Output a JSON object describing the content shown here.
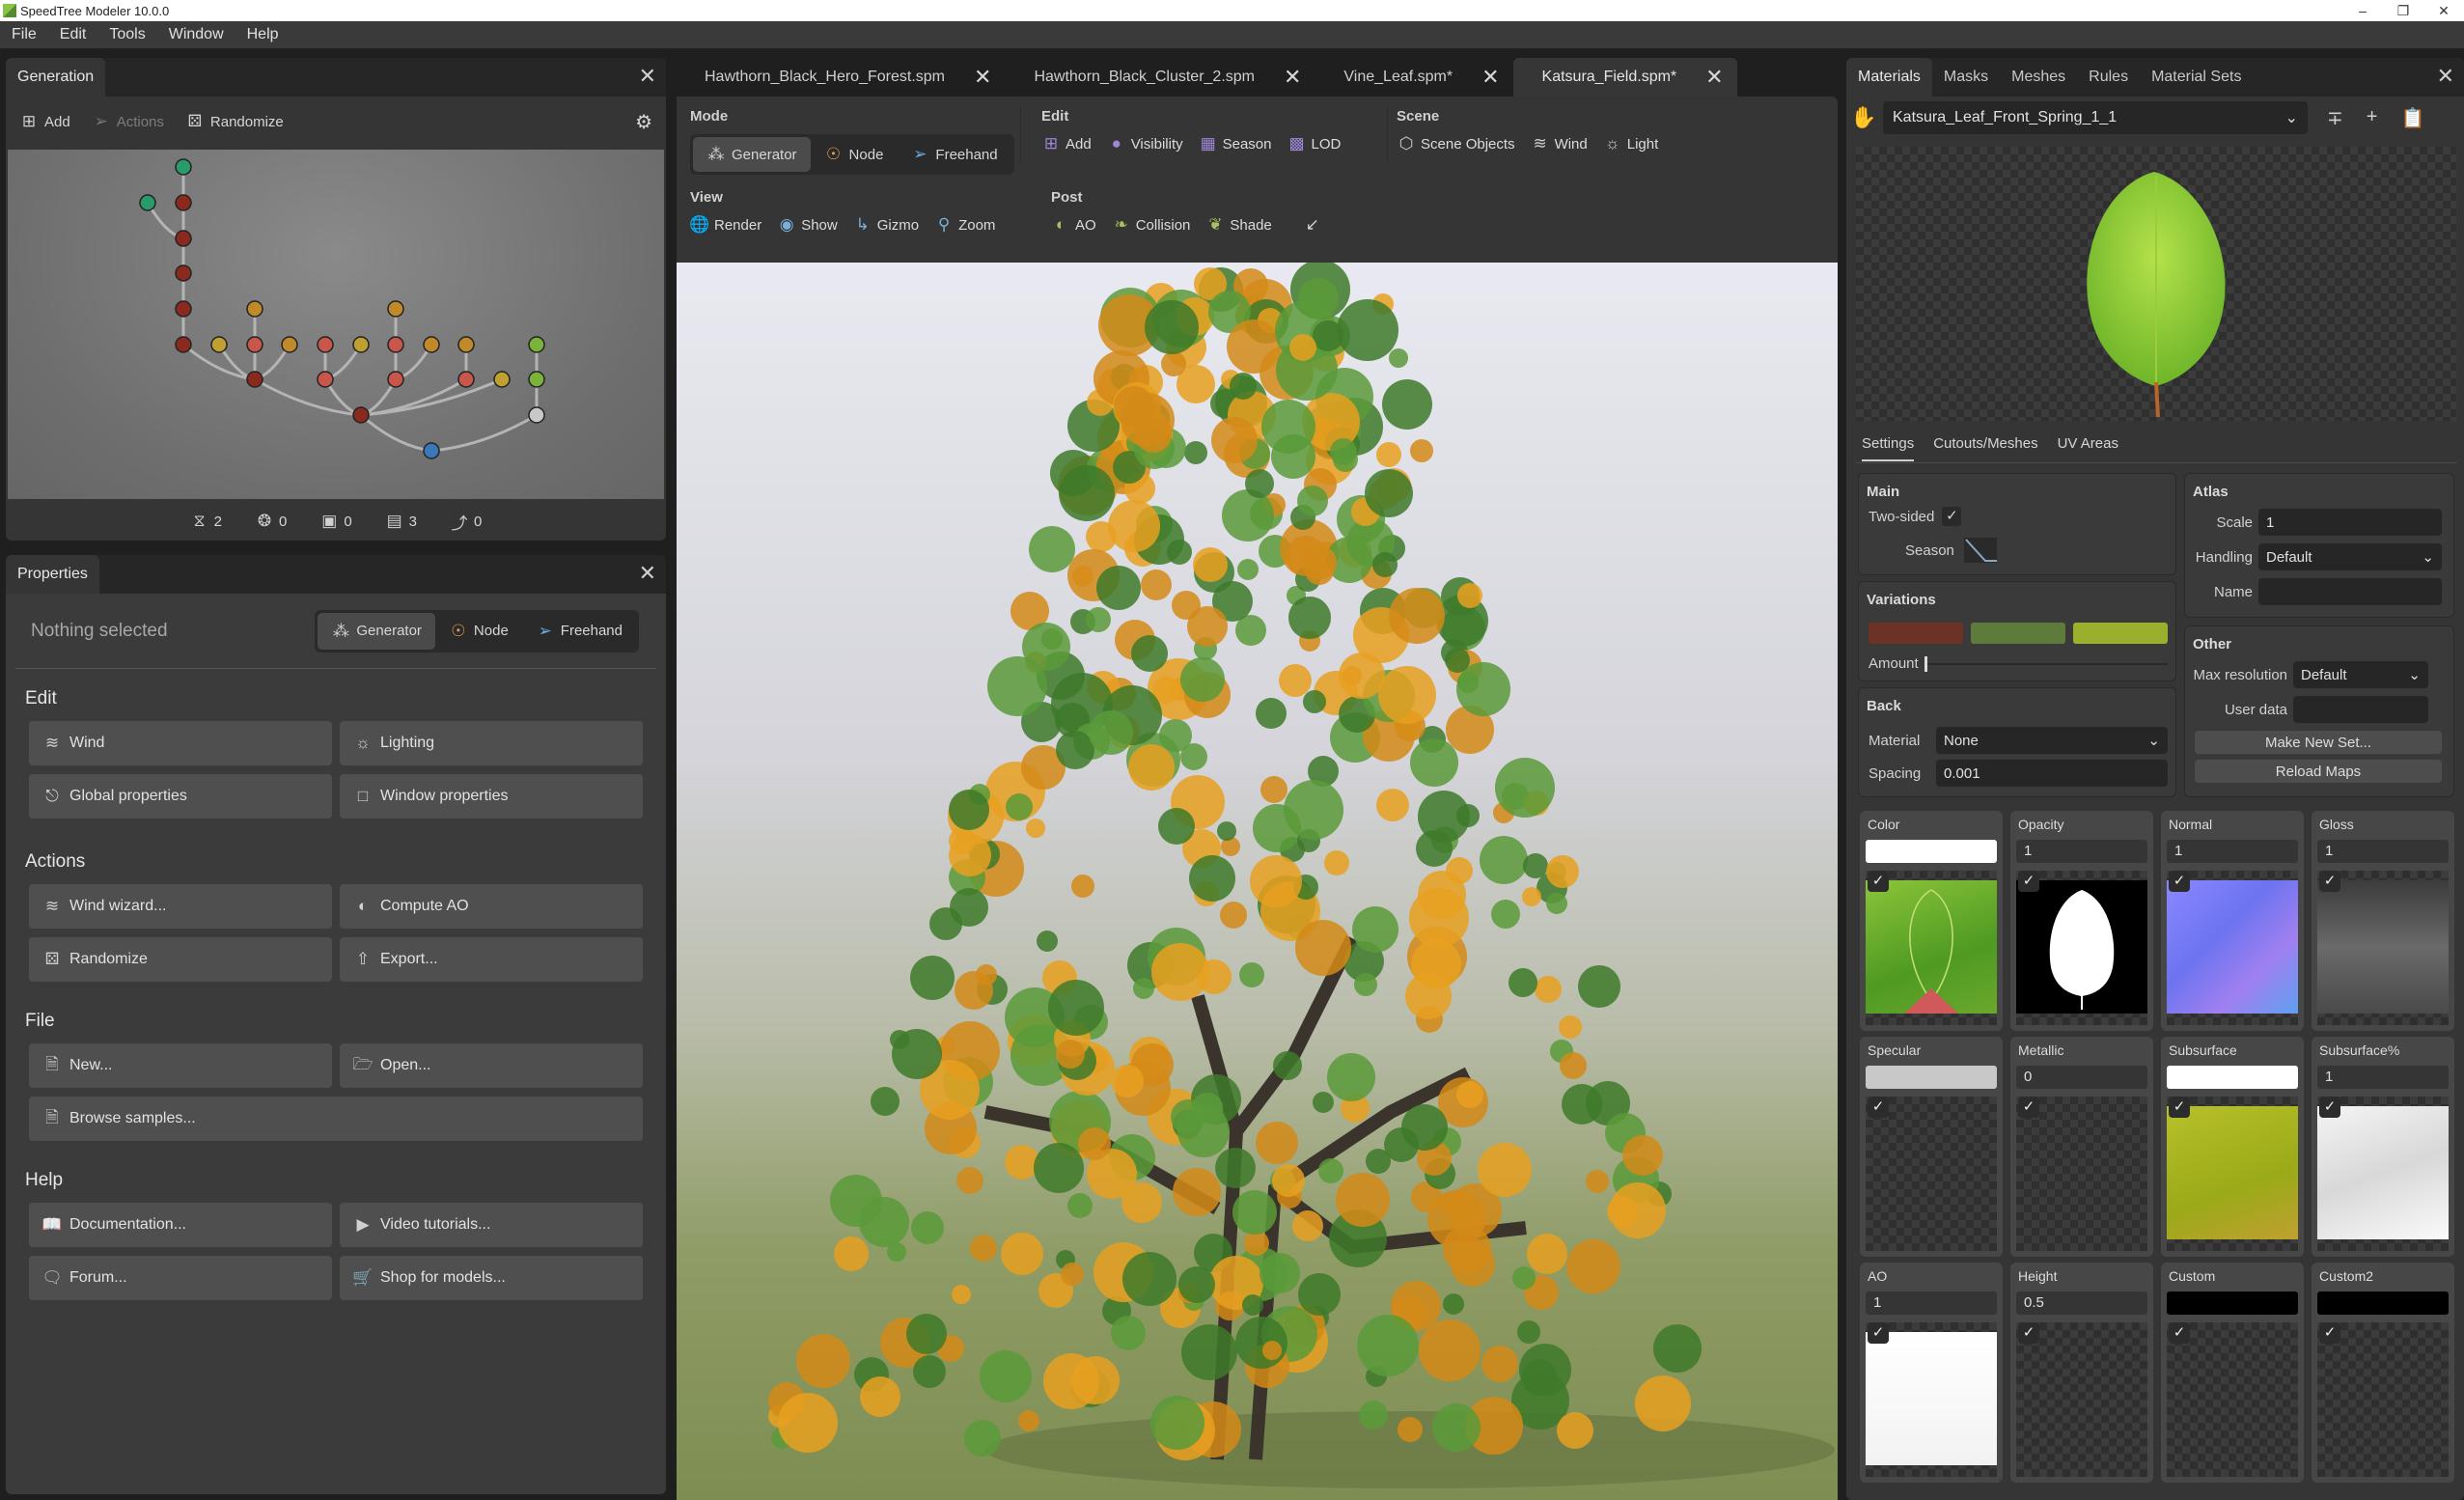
{
  "app": {
    "title": "SpeedTree Modeler 10.0.0",
    "window_controls": [
      "minimize",
      "restore",
      "close"
    ]
  },
  "menu": [
    "File",
    "Edit",
    "Tools",
    "Window",
    "Help"
  ],
  "generation": {
    "tab": "Generation",
    "toolbar": {
      "add": "Add",
      "actions": "Actions",
      "randomize": "Randomize"
    },
    "graph_nodes": [
      {
        "type": "leaf"
      },
      {
        "type": "leaf"
      },
      {
        "type": "branch"
      },
      {
        "type": "branch"
      },
      {
        "type": "branch"
      },
      {
        "type": "branch"
      },
      {
        "type": "cap"
      },
      {
        "type": "cap"
      },
      {
        "type": "branch"
      },
      {
        "type": "knot"
      },
      {
        "type": "branch-light"
      },
      {
        "type": "cap"
      },
      {
        "type": "branch-light"
      },
      {
        "type": "knot"
      },
      {
        "type": "branch-light"
      },
      {
        "type": "cap"
      },
      {
        "type": "cap"
      },
      {
        "type": "moss"
      },
      {
        "type": "branch"
      },
      {
        "type": "branch-light"
      },
      {
        "type": "branch-light"
      },
      {
        "type": "branch-light"
      },
      {
        "type": "knot"
      },
      {
        "type": "moss"
      },
      {
        "type": "trunk"
      },
      {
        "type": "moss-base"
      },
      {
        "type": "tree-root"
      }
    ],
    "stats": [
      {
        "icon": "magnet-icon",
        "value": "2"
      },
      {
        "icon": "materials-icon",
        "value": "0"
      },
      {
        "icon": "camera-icon",
        "value": "0"
      },
      {
        "icon": "lod-icon",
        "value": "3"
      },
      {
        "icon": "spline-icon",
        "value": "0"
      }
    ]
  },
  "properties": {
    "tab": "Properties",
    "status": "Nothing selected",
    "modes": [
      "Generator",
      "Node",
      "Freehand"
    ],
    "active_mode": "Generator",
    "sections": [
      {
        "title": "Edit",
        "buttons": [
          {
            "label": "Wind",
            "icon": "wind-icon"
          },
          {
            "label": "Lighting",
            "icon": "sun-icon"
          },
          {
            "label": "Global properties",
            "icon": "tree-icon"
          },
          {
            "label": "Window properties",
            "icon": "window-icon"
          }
        ]
      },
      {
        "title": "Actions",
        "buttons": [
          {
            "label": "Wind wizard...",
            "icon": "wind-wizard-icon"
          },
          {
            "label": "Compute AO",
            "icon": "ao-icon"
          },
          {
            "label": "Randomize",
            "icon": "dice-icon"
          },
          {
            "label": "Export...",
            "icon": "export-icon"
          }
        ]
      },
      {
        "title": "File",
        "buttons": [
          {
            "label": "New...",
            "icon": "new-file-icon"
          },
          {
            "label": "Open...",
            "icon": "folder-icon"
          },
          {
            "label": "Browse samples...",
            "icon": "browse-icon",
            "wide": true
          }
        ]
      },
      {
        "title": "Help",
        "buttons": [
          {
            "label": "Documentation...",
            "icon": "book-icon"
          },
          {
            "label": "Video tutorials...",
            "icon": "video-icon"
          },
          {
            "label": "Forum...",
            "icon": "chat-icon"
          },
          {
            "label": "Shop for models...",
            "icon": "cart-icon"
          }
        ]
      }
    ]
  },
  "documents": {
    "tabs": [
      {
        "label": "Hawthorn_Black_Hero_Forest.spm",
        "active": false
      },
      {
        "label": "Hawthorn_Black_Cluster_2.spm",
        "active": false
      },
      {
        "label": "Vine_Leaf.spm*",
        "active": false
      },
      {
        "label": "Katsura_Field.spm*",
        "active": true
      }
    ]
  },
  "toolbar": {
    "mode": {
      "title": "Mode",
      "items": [
        "Generator",
        "Node",
        "Freehand"
      ],
      "active": "Generator"
    },
    "edit": {
      "title": "Edit",
      "items": [
        "Add",
        "Visibility",
        "Season",
        "LOD"
      ]
    },
    "scene": {
      "title": "Scene",
      "items": [
        "Scene Objects",
        "Wind",
        "Light"
      ]
    },
    "view": {
      "title": "View",
      "items": [
        "Render",
        "Show",
        "Gizmo",
        "Zoom"
      ]
    },
    "post": {
      "title": "Post",
      "items": [
        "AO",
        "Collision",
        "Shade"
      ]
    }
  },
  "materials": {
    "tabs": [
      "Materials",
      "Masks",
      "Meshes",
      "Rules",
      "Material Sets"
    ],
    "active_tab": "Materials",
    "selected_material": "Katsura_Leaf_Front_Spring_1_1",
    "sub_tabs": [
      "Settings",
      "Cutouts/Meshes",
      "UV Areas"
    ],
    "active_sub_tab": "Settings",
    "main": {
      "title": "Main",
      "two_sided_label": "Two-sided",
      "two_sided": true,
      "season_label": "Season"
    },
    "variations": {
      "title": "Variations",
      "colors": [
        "#6b3226",
        "#5f7b3c",
        "#9aaf2c"
      ],
      "amount_label": "Amount",
      "amount": 0
    },
    "back": {
      "title": "Back",
      "material_label": "Material",
      "material": "None",
      "spacing_label": "Spacing",
      "spacing": "0.001"
    },
    "atlas": {
      "title": "Atlas",
      "scale_label": "Scale",
      "scale": "1",
      "handling_label": "Handling",
      "handling": "Default",
      "name_label": "Name",
      "name": ""
    },
    "other": {
      "title": "Other",
      "max_res_label": "Max resolution",
      "max_res": "Default",
      "user_data_label": "User data",
      "user_data": "",
      "make_new_set": "Make New Set...",
      "reload_maps": "Reload Maps"
    },
    "maps": [
      {
        "label": "Color",
        "value": "",
        "swatch": "#ffffff",
        "enabled": true,
        "thumb": "color"
      },
      {
        "label": "Opacity",
        "value": "1",
        "enabled": true,
        "thumb": "opacity"
      },
      {
        "label": "Normal",
        "value": "1",
        "enabled": true,
        "thumb": "normal"
      },
      {
        "label": "Gloss",
        "value": "1",
        "enabled": true,
        "thumb": "gloss"
      },
      {
        "label": "Specular",
        "value": "",
        "swatch": "#c8c8c8",
        "enabled": true,
        "thumb": "none"
      },
      {
        "label": "Metallic",
        "value": "0",
        "enabled": true,
        "thumb": "none"
      },
      {
        "label": "Subsurface",
        "value": "",
        "swatch": "#ffffff",
        "enabled": true,
        "thumb": "subsurface"
      },
      {
        "label": "Subsurface%",
        "value": "1",
        "enabled": true,
        "thumb": "subsurface-pct"
      },
      {
        "label": "AO",
        "value": "1",
        "enabled": true,
        "thumb": "ao"
      },
      {
        "label": "Height",
        "value": "0.5",
        "enabled": true,
        "thumb": "none"
      },
      {
        "label": "Custom",
        "value": "",
        "swatch": "#000000",
        "enabled": true,
        "thumb": "none"
      },
      {
        "label": "Custom2",
        "value": "",
        "swatch": "#000000",
        "enabled": true,
        "thumb": "none"
      }
    ]
  },
  "colors": {
    "node_orange": "#e0a050",
    "freehand_blue": "#6ab0e8",
    "edit_purple": "#9f86d8",
    "post_green": "#a8c060",
    "view_blue": "#7ab0d8"
  }
}
